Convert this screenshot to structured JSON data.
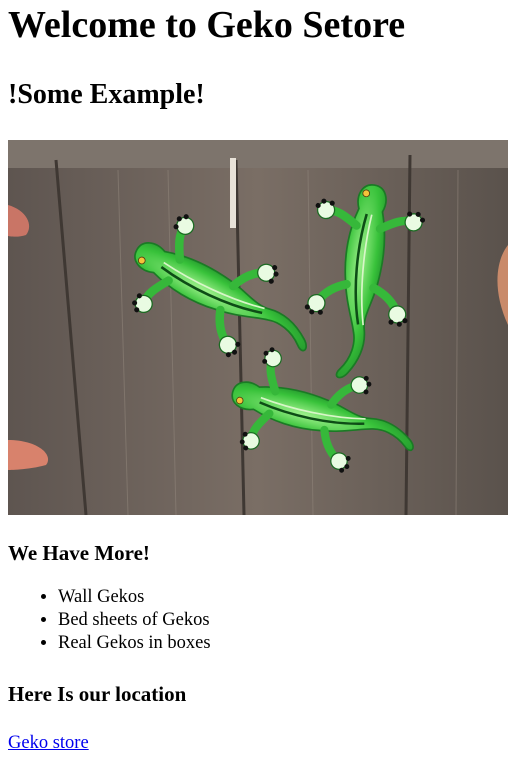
{
  "page": {
    "title": "Welcome to Geko Setore",
    "subtitle": "!Some Example!",
    "more_heading": "We Have More!",
    "items": [
      "Wall Gekos",
      "Bed sheets of Gekos",
      "Real Gekos in boxes"
    ],
    "location_heading": "Here Is our location",
    "store_link": "Geko store"
  },
  "colors": {
    "link": "#0000ee",
    "gecko_green": "#3fc23d",
    "fence_wood": "#6f6459"
  },
  "image": {
    "subject": "three green gecko wall decorations on a wooden fence"
  }
}
